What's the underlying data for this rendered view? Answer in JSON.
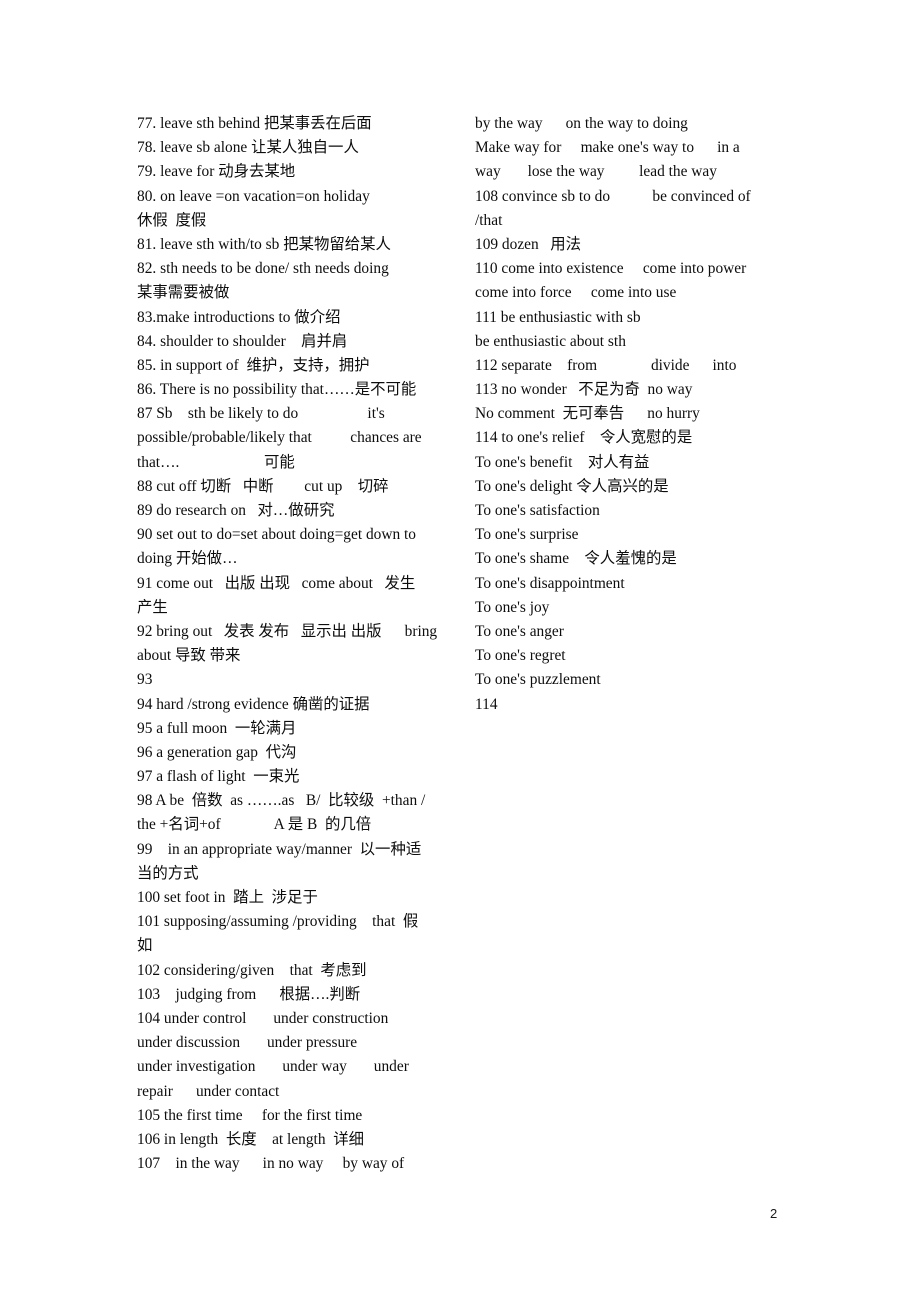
{
  "document": {
    "page_number": "2",
    "left_column": [
      "77. leave sth behind 把某事丢在后面",
      "78. leave sb alone 让某人独自一人",
      "79. leave for 动身去某地",
      "80. on leave =on vacation=on holiday",
      "休假  度假",
      "81. leave sth with/to sb 把某物留给某人",
      "82. sth needs to be done/ sth needs doing",
      "某事需要被做",
      "83.make introductions to 做介绍",
      "84. shoulder to shoulder    肩并肩",
      "85. in support of  维护，支持，拥护",
      "86. There is no possibility that……是不可能",
      "87 Sb    sth be likely to do                  it's",
      "possible/probable/likely that          chances are",
      "that….                      可能",
      "88 cut off 切断   中断        cut up    切碎",
      "89 do research on   对…做研究",
      "90 set out to do=set about doing=get down to",
      "doing 开始做…",
      "91 come out   出版 出现   come about   发生",
      "产生",
      "92 bring out   发表 发布   显示出 出版      bring",
      "about 导致 带来",
      "93",
      "94 hard /strong evidence 确凿的证据",
      "95 a full moon  一轮满月",
      "96 a generation gap  代沟",
      "97 a flash of light  一束光",
      "98 A be  倍数  as …….as   B/  比较级  +than /",
      "the +名词+of              A 是 B  的几倍",
      "99    in an appropriate way/manner  以一种适",
      "当的方式",
      "100 set foot in  踏上  涉足于",
      "101 supposing/assuming /providing    that  假",
      "如",
      "102 considering/given    that  考虑到",
      "103    judging from      根据….判断",
      "104 under control       under construction",
      "under discussion       under pressure",
      "under investigation       under way       under",
      "repair      under contact",
      "105 the first time     for the first time",
      "106 in length  长度    at length  详细",
      "107    in the way      in no way     by way of"
    ],
    "right_column": [
      "by the way      on the way to doing",
      "Make way for     make one's way to      in a",
      "way       lose the way         lead the way",
      "108 convince sb to do           be convinced of",
      "/that",
      "109 dozen   用法",
      "110 come into existence     come into power",
      "come into force     come into use",
      "111 be enthusiastic with sb",
      "be enthusiastic about sth",
      "112 separate    from              divide      into",
      "113 no wonder   不足为奇  no way",
      "No comment  无可奉告      no hurry",
      "114 to one's relief    令人宽慰的是",
      "To one's benefit    对人有益",
      "To one's delight 令人高兴的是",
      "To one's satisfaction",
      "To one's surprise",
      "To one's shame    令人羞愧的是",
      "To one's disappointment",
      "To one's joy",
      "To one's anger",
      "To one's regret",
      "To one's puzzlement",
      "114"
    ]
  }
}
